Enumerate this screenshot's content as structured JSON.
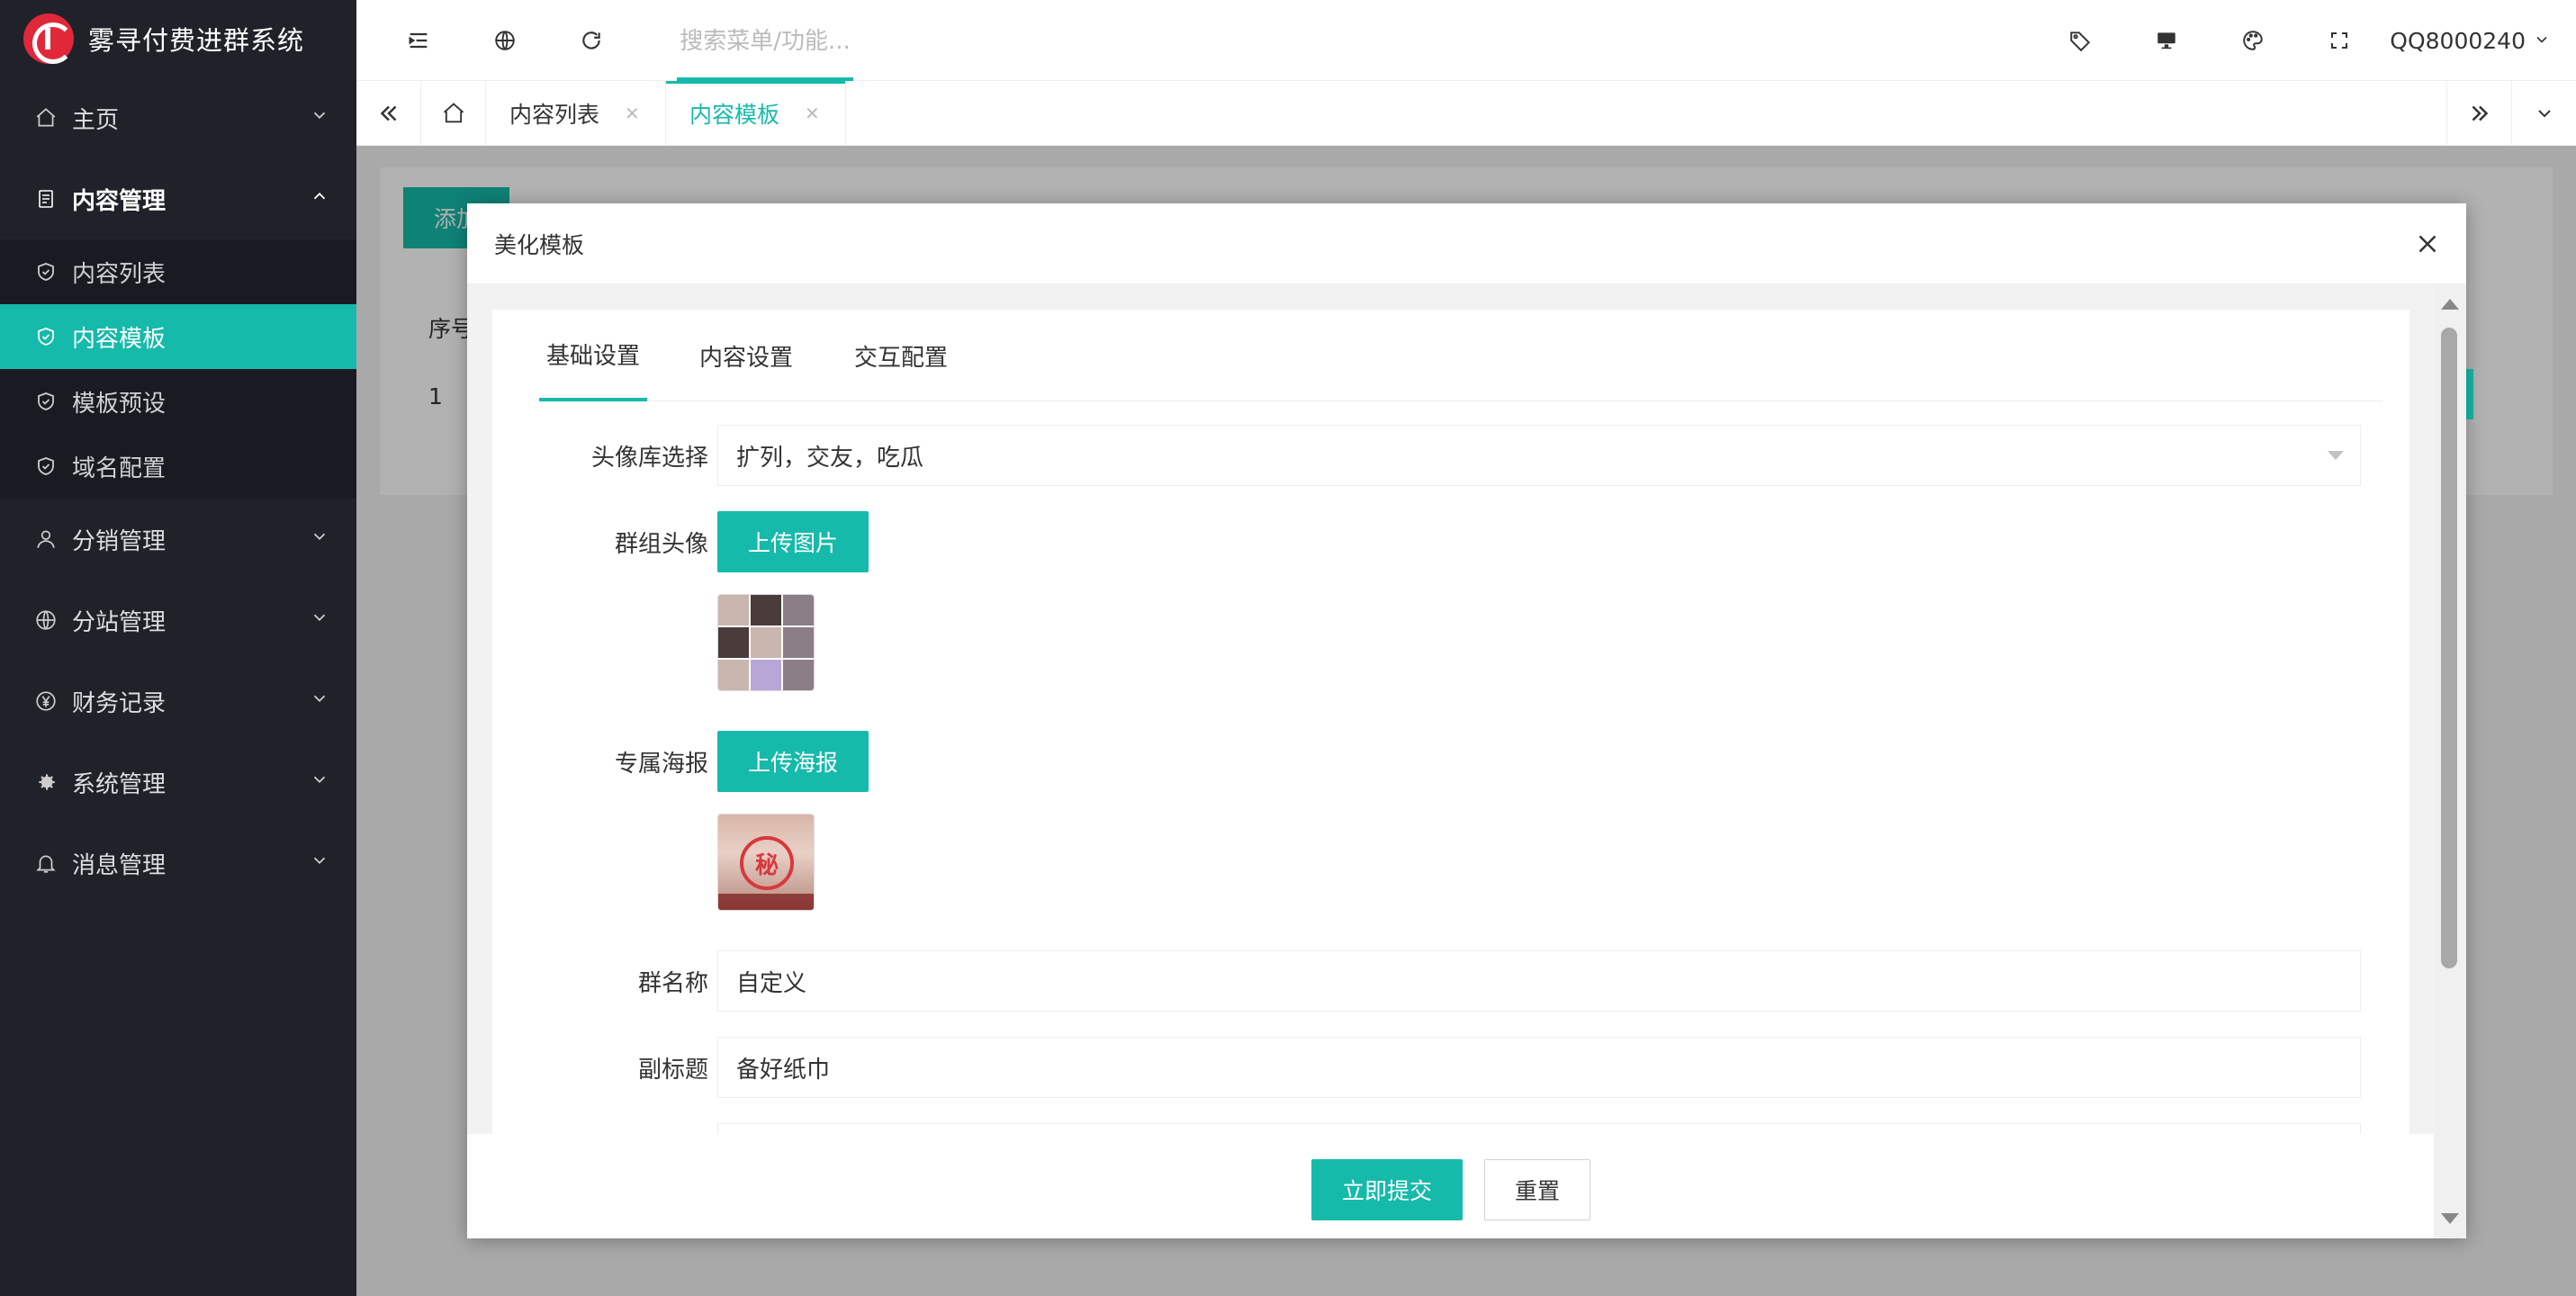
{
  "app": {
    "title": "雾寻付费进群系统"
  },
  "sidebar": {
    "items": [
      {
        "label": "主页",
        "icon": "home-icon"
      },
      {
        "label": "内容管理",
        "icon": "document-icon"
      },
      {
        "label": "分销管理",
        "icon": "user-icon"
      },
      {
        "label": "分站管理",
        "icon": "globe-icon"
      },
      {
        "label": "财务记录",
        "icon": "yen-icon"
      },
      {
        "label": "系统管理",
        "icon": "gear-icon"
      },
      {
        "label": "消息管理",
        "icon": "bell-icon"
      }
    ],
    "sub_items": [
      {
        "label": "内容列表"
      },
      {
        "label": "内容模板"
      },
      {
        "label": "模板预设"
      },
      {
        "label": "域名配置"
      }
    ]
  },
  "header": {
    "search_placeholder": "搜索菜单/功能...",
    "user": "QQ8000240"
  },
  "tabs": [
    {
      "label": "内容列表"
    },
    {
      "label": "内容模板"
    }
  ],
  "content": {
    "add_button": "添加",
    "col_index": "序号",
    "row_index": "1"
  },
  "modal": {
    "title": "美化模板",
    "tabs": [
      "基础设置",
      "内容设置",
      "交互配置"
    ],
    "fields": {
      "avatar_lib_label": "头像库选择",
      "avatar_lib_value": "扩列，交友，吃瓜",
      "group_avatar_label": "群组头像",
      "upload_image": "上传图片",
      "poster_label": "专属海报",
      "upload_poster": "上传海报",
      "poster_seal": "秘",
      "group_name_label": "群名称",
      "group_name_value": "自定义",
      "subtitle_label": "副标题",
      "subtitle_value": "备好纸巾"
    },
    "submit": "立即提交",
    "reset": "重置"
  },
  "colors": {
    "accent": "#16baaa",
    "sidebar": "#20222a",
    "logo": "#e0283a"
  }
}
